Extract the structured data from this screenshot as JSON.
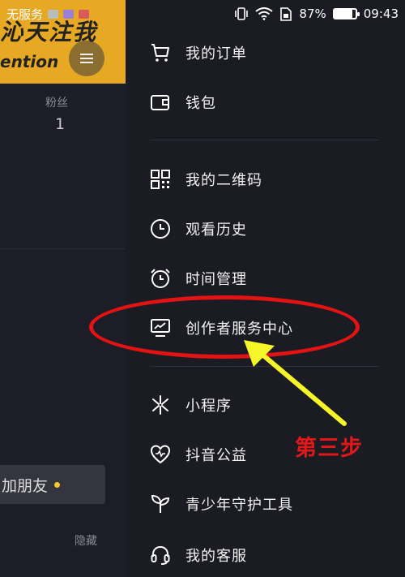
{
  "status_bar": {
    "carrier": "无服务",
    "battery_percent": "87%",
    "time": "09:43",
    "icons": [
      "image-icon",
      "app-icon",
      "app-icon",
      "vibrate-icon",
      "wifi-icon",
      "sim-icon",
      "battery-icon"
    ]
  },
  "background_profile": {
    "banner_text_large": "沁天注我",
    "banner_text_small": "ention",
    "fans_label": "粉丝",
    "fans_count": "1",
    "add_friend_label": "加朋友",
    "hide_label": "隐藏"
  },
  "drawer": {
    "items": [
      {
        "label": "我的订单",
        "icon": "cart-icon"
      },
      {
        "label": "钱包",
        "icon": "wallet-icon"
      },
      {
        "label": "我的二维码",
        "icon": "qrcode-icon"
      },
      {
        "label": "观看历史",
        "icon": "clock-icon"
      },
      {
        "label": "时间管理",
        "icon": "alarm-icon"
      },
      {
        "label": "创作者服务中心",
        "icon": "monitor-chart-icon"
      },
      {
        "label": "小程序",
        "icon": "asterisk-icon"
      },
      {
        "label": "抖音公益",
        "icon": "heart-icon"
      },
      {
        "label": "青少年守护工具",
        "icon": "sprout-icon"
      },
      {
        "label": "我的客服",
        "icon": "headset-icon"
      }
    ]
  },
  "annotation": {
    "label": "第三步",
    "color": "#e01818",
    "arrow_color": "#f5f52a"
  }
}
